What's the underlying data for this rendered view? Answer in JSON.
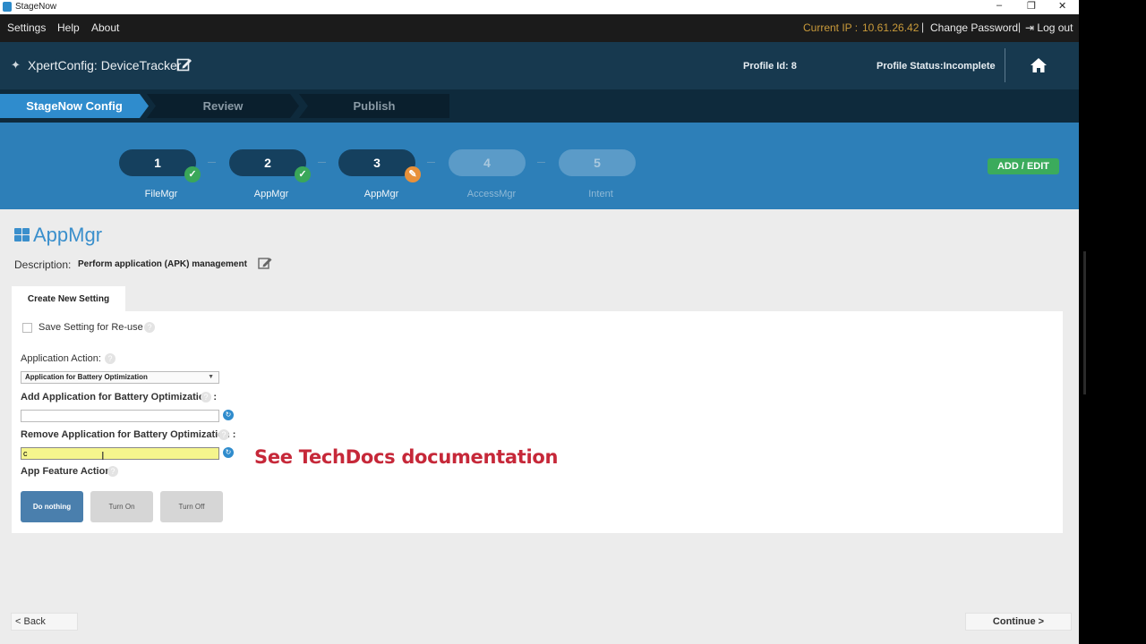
{
  "window": {
    "title": "StageNow",
    "minimize": "–",
    "restore": "❐",
    "close": "✕"
  },
  "menu": {
    "settings": "Settings",
    "help": "Help",
    "about": "About",
    "current_ip_label": "Current IP :",
    "current_ip": "10.61.26.42",
    "change_password": "Change Password",
    "logout": "Log out"
  },
  "header": {
    "title": "XpertConfig: DeviceTracker",
    "profile_id": "Profile Id: 8",
    "profile_status": "Profile Status:Incomplete"
  },
  "breadcrumbs": [
    "StageNow Config",
    "Review",
    "Publish"
  ],
  "steps": [
    {
      "number": "1",
      "label": "FileMgr",
      "state": "done"
    },
    {
      "number": "2",
      "label": "AppMgr",
      "state": "done"
    },
    {
      "number": "3",
      "label": "AppMgr",
      "state": "editing"
    },
    {
      "number": "4",
      "label": "AccessMgr",
      "state": "future"
    },
    {
      "number": "5",
      "label": "Intent",
      "state": "future"
    }
  ],
  "badges": {
    "done": "✓",
    "editing": "✎"
  },
  "add_edit_button": "ADD / EDIT",
  "page": {
    "title": "AppMgr",
    "description_label": "Description:",
    "description": "Perform application (APK) management",
    "tab": "Create New Setting"
  },
  "form": {
    "save_setting_label": "Save Setting for Re-use",
    "app_action_label": "Application Action:",
    "app_action_value": "Application for Battery Optimization",
    "add_app_label": "Add Application for Battery Optimization :",
    "add_app_value": "",
    "remove_app_label": "Remove Application for Battery Optimization :",
    "remove_app_value": "c",
    "feature_action_label": "App Feature Action:",
    "feature_buttons": [
      "Do nothing",
      "Turn On",
      "Turn Off"
    ],
    "selected_feature": "Do nothing"
  },
  "overlay_text": "See TechDocs documentation",
  "nav": {
    "back": "<  Back",
    "continue": "Continue  >"
  },
  "colors": {
    "accent": "#2f8ccd",
    "header": "#17394f",
    "ok": "#3aa759",
    "edit": "#e8913a",
    "overlay": "#c62839"
  }
}
